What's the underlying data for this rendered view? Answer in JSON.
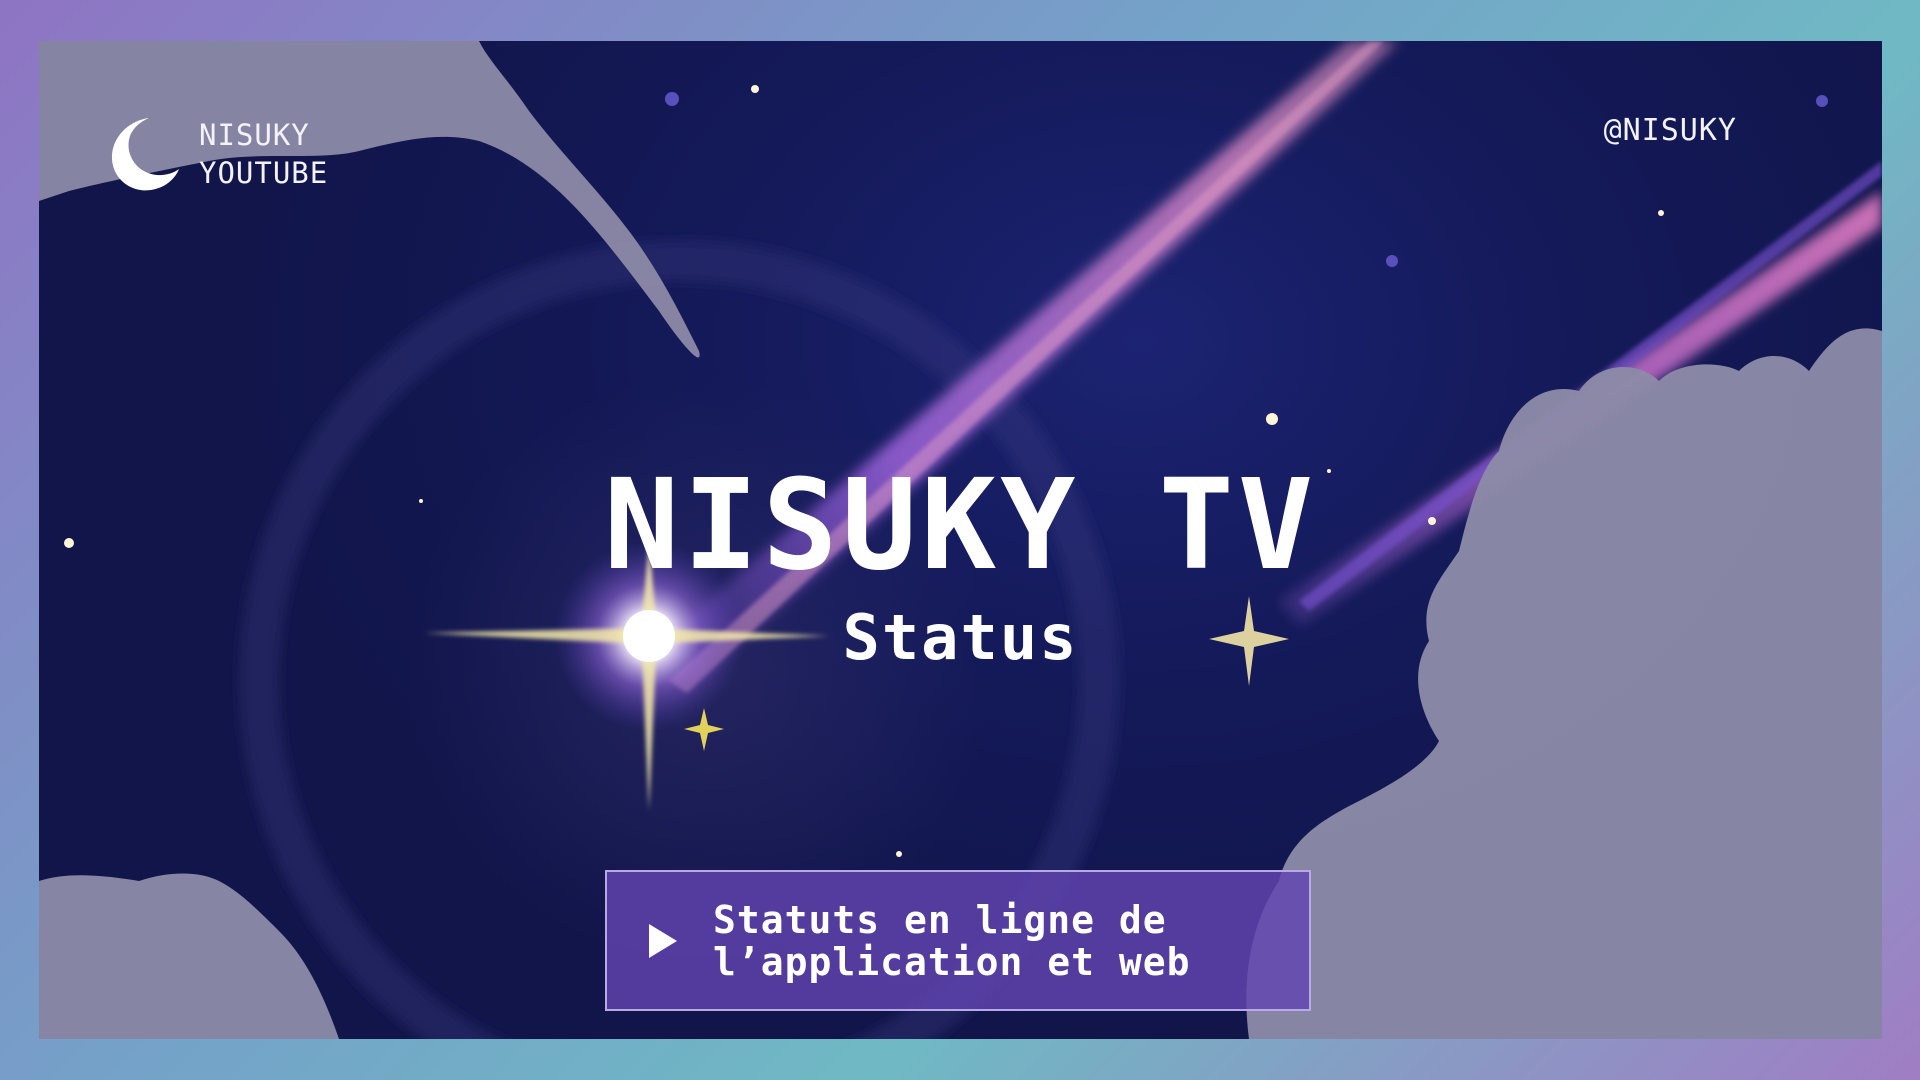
{
  "brand": {
    "line1": "NISUKY",
    "line2": "YOUTUBE",
    "icon": "crescent-moon-icon"
  },
  "handle": "@NISUKY",
  "hero": {
    "title": "NISUKY TV",
    "subtitle": "Status"
  },
  "cta": {
    "icon": "play-icon",
    "line1": "Statuts en ligne de",
    "line2": "l’application et web"
  },
  "colors": {
    "sky": "#141a5a",
    "cloud": "#8b89a8",
    "accent": "#6244b0",
    "meteor": "#a46ad6"
  }
}
